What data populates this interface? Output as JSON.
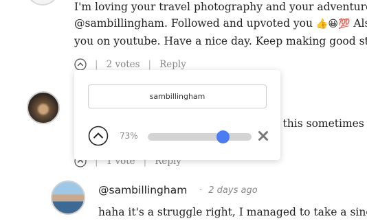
{
  "comment_top": {
    "line1": "I'm loving your travel photography and your adventures",
    "line2_a": "@sambillingham. Followed and upvoted you ",
    "line2_emoji": "👍😀💯",
    "line2_b": " Also",
    "line3": "you on youtube. Have a nice day. Keep making good stu",
    "votes": "2 votes",
    "reply": "Reply"
  },
  "comment_mid": {
    "partial_text": "r, this sometimes",
    "votes": "1 vote",
    "reply": "Reply"
  },
  "vote_popup": {
    "username": "sambillingham",
    "percent_label": "73%",
    "weight_percent": 73,
    "accent_color": "#4a7cf2"
  },
  "reply_comment": {
    "author": "@sambillingham",
    "separator": "·",
    "time": "2 days ago",
    "text": "haha it's a struggle right, I managed to take a singl"
  }
}
